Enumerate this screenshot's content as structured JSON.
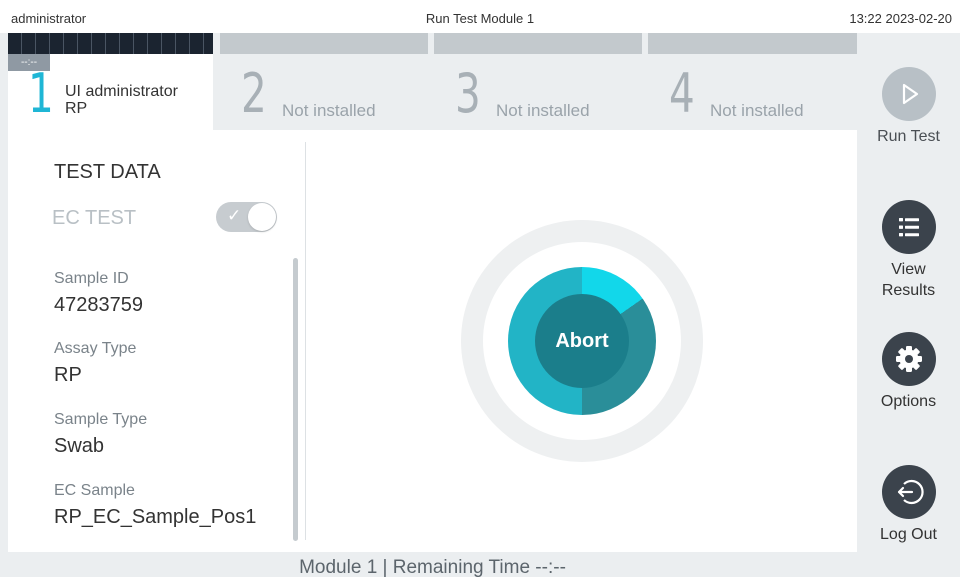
{
  "topbar": {
    "user": "administrator",
    "title": "Run Test Module 1",
    "datetime": "13:22 2023-02-20"
  },
  "tabs": [
    {
      "number": "1",
      "badge": "--:--",
      "line1": "UI administrator",
      "line2": "RP",
      "active": true
    },
    {
      "number": "2",
      "status": "Not installed",
      "active": false
    },
    {
      "number": "3",
      "status": "Not installed",
      "active": false
    },
    {
      "number": "4",
      "status": "Not installed",
      "active": false
    }
  ],
  "test_data": {
    "title": "TEST DATA",
    "ec_test_label": "EC TEST",
    "ec_test_enabled": true,
    "fields": [
      {
        "label": "Sample ID",
        "value": "47283759"
      },
      {
        "label": "Assay Type",
        "value": "RP"
      },
      {
        "label": "Sample Type",
        "value": "Swab"
      },
      {
        "label": "EC Sample",
        "value": "RP_EC_Sample_Pos1"
      }
    ]
  },
  "abort": {
    "label": "Abort"
  },
  "status_bar": {
    "text": "Module 1  |  Remaining Time  --:--"
  },
  "sidebar": {
    "run_test": "Run Test",
    "view_results_1": "View",
    "view_results_2": "Results",
    "options": "Options",
    "log_out": "Log Out"
  },
  "colors": {
    "accent": "#1fb6d5",
    "abort_fill": "#22b4c6",
    "sidebar_icon": "#3b434c"
  }
}
